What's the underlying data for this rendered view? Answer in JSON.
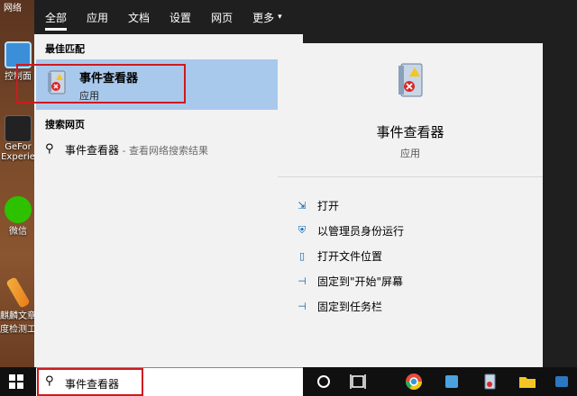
{
  "desktop": {
    "icons": [
      {
        "label": "控制面",
        "color": "#3b8fd9"
      },
      {
        "label": "GeFor",
        "label2": "Experie",
        "color": "#222222"
      },
      {
        "label": "微信",
        "color": "#2dc100"
      },
      {
        "label": "麒麟文章",
        "label2": "度检测工",
        "color": "#e87a1e"
      }
    ],
    "top_label": "网络"
  },
  "tabs": [
    {
      "label": "全部",
      "active": true
    },
    {
      "label": "应用"
    },
    {
      "label": "文档"
    },
    {
      "label": "设置"
    },
    {
      "label": "网页"
    },
    {
      "label": "更多",
      "caret": "▾"
    }
  ],
  "left": {
    "best_match_title": "最佳匹配",
    "best_match": {
      "name": "事件查看器",
      "type": "应用"
    },
    "web_title": "搜索网页",
    "web_result": {
      "query": "事件查看器",
      "hint": " - 查看网络搜索结果"
    }
  },
  "right": {
    "name": "事件查看器",
    "type": "应用",
    "actions": [
      {
        "label": "打开",
        "icon": "open-icon"
      },
      {
        "label": "以管理员身份运行",
        "icon": "shield-icon"
      },
      {
        "label": "打开文件位置",
        "icon": "file-icon"
      },
      {
        "label": "固定到\"开始\"屏幕",
        "icon": "pin-icon"
      },
      {
        "label": "固定到任务栏",
        "icon": "pin-icon"
      }
    ]
  },
  "search": {
    "value": "事件查看器"
  },
  "colors": {
    "accent": "#0063b1",
    "highlight": "#d0191f",
    "selected": "#a9c9ec"
  }
}
